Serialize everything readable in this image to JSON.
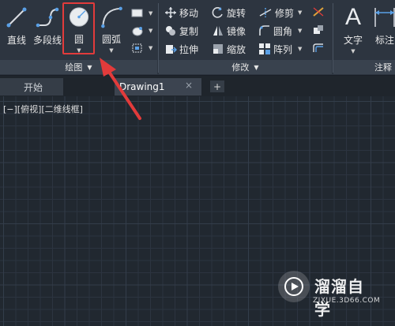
{
  "ribbon": {
    "draw_group": {
      "title": "绘图",
      "tools": {
        "line": "直线",
        "polyline": "多段线",
        "circle": "圆",
        "arc": "圆弧"
      }
    },
    "modify_group": {
      "title": "修改",
      "tools": {
        "move": "移动",
        "rotate": "旋转",
        "trim": "修剪",
        "copy": "复制",
        "mirror": "镜像",
        "fillet": "圆角",
        "stretch": "拉伸",
        "scale": "缩放",
        "array": "阵列"
      }
    },
    "annotation_group": {
      "title": "注释",
      "tools": {
        "text": "文字",
        "dimension": "标注"
      }
    }
  },
  "tabs": {
    "start": "开始",
    "drawing": "Drawing1",
    "close": "×",
    "add": "+"
  },
  "canvas": {
    "viewport_label": "[−][俯视][二维线框]"
  },
  "watermark": {
    "name": "溜溜自学",
    "url": "ZIXUE.3D66.COM"
  },
  "colors": {
    "highlight": "#e23b3b",
    "ribbon_bg": "#2d3540",
    "canvas_bg": "#212830"
  }
}
